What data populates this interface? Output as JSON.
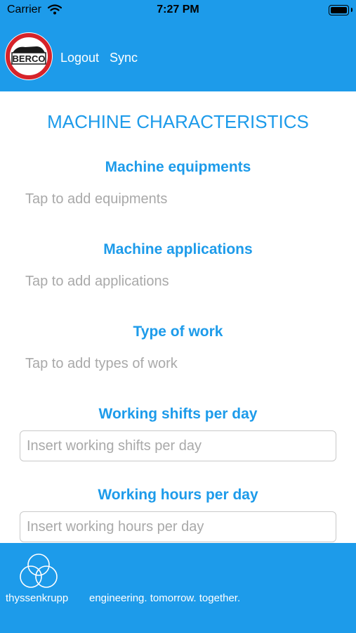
{
  "status_bar": {
    "carrier": "Carrier",
    "time": "7:27 PM",
    "wifi_icon": "wifi-icon",
    "battery_icon": "battery-icon"
  },
  "header": {
    "logo_text": "BERCO",
    "logout_label": "Logout",
    "sync_label": "Sync",
    "background_color": "#1d9bea"
  },
  "main": {
    "title": "MACHINE CHARACTERISTICS",
    "sections": [
      {
        "heading": "Machine equipments",
        "tap_text": "Tap to add equipments"
      },
      {
        "heading": "Machine applications",
        "tap_text": "Tap to add applications"
      },
      {
        "heading": "Type of work",
        "tap_text": "Tap to add types of work"
      },
      {
        "heading": "Working shifts per day",
        "placeholder": "Insert working shifts per day",
        "value": ""
      },
      {
        "heading": "Working hours per day",
        "placeholder": "Insert working hours per day",
        "value": ""
      }
    ],
    "accent_color": "#1d9bea"
  },
  "footer": {
    "company": "thyssenkrupp",
    "slogan": "engineering. tomorrow. together.",
    "logo_icon": "thyssenkrupp-logo-icon"
  }
}
